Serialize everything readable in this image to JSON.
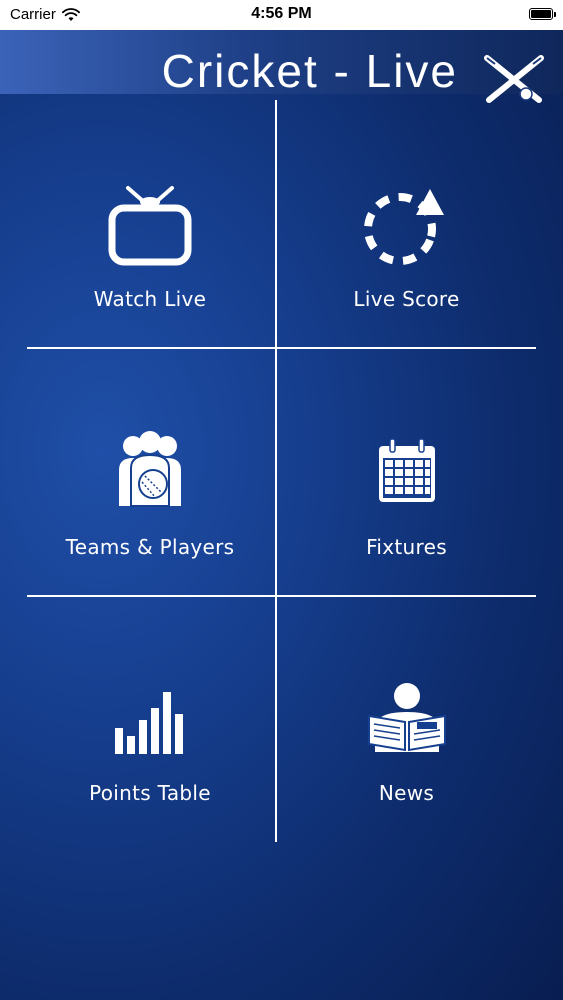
{
  "status_bar": {
    "carrier": "Carrier",
    "time": "4:56 PM"
  },
  "header": {
    "title": "Cricket - Live",
    "logo_icon": "crossed-bats-ball-icon"
  },
  "menu": {
    "items": [
      {
        "label": "Watch Live",
        "icon": "tv-icon"
      },
      {
        "label": "Live Score",
        "icon": "refresh-cycle-icon"
      },
      {
        "label": "Teams & Players",
        "icon": "team-players-icon"
      },
      {
        "label": "Fixtures",
        "icon": "calendar-icon"
      },
      {
        "label": "Points Table",
        "icon": "bar-chart-icon"
      },
      {
        "label": "News",
        "icon": "newspaper-reader-icon"
      }
    ]
  },
  "colors": {
    "background_light": "#1f4fa8",
    "background_dark": "#071a4a",
    "foreground": "#ffffff",
    "status_bar_bg": "#ffffff"
  }
}
